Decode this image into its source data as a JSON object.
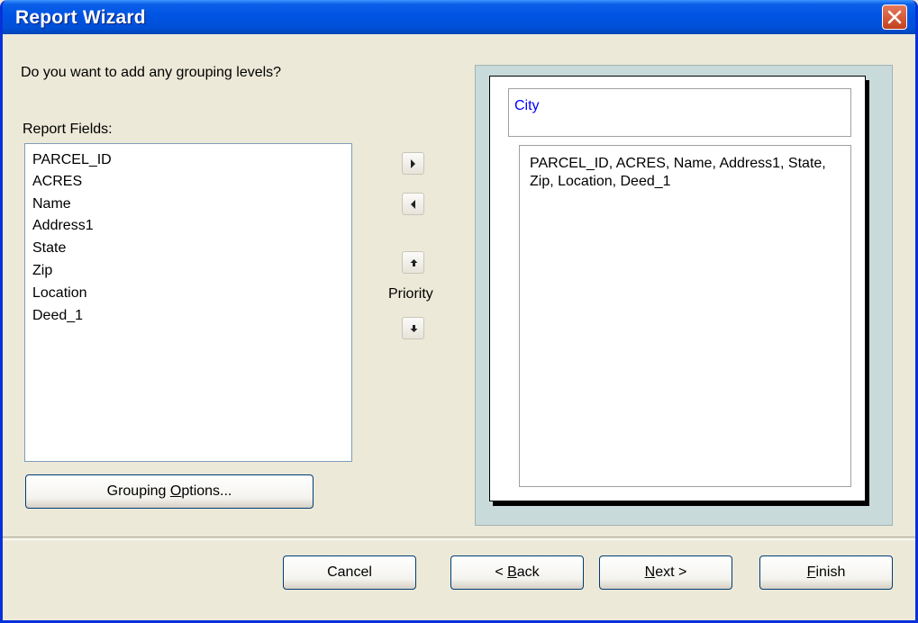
{
  "window": {
    "title": "Report Wizard"
  },
  "prompt": "Do you want to add any grouping levels?",
  "fields_label": "Report Fields:",
  "report_fields": [
    "PARCEL_ID",
    "ACRES",
    "Name",
    "Address1",
    "State",
    "Zip",
    "Location",
    "Deed_1"
  ],
  "grouping_button": {
    "before": "Grouping ",
    "mnemonic": "O",
    "after": "ptions..."
  },
  "priority_label": "Priority",
  "preview": {
    "group_field": "City",
    "detail_fields": "PARCEL_ID, ACRES, Name, Address1, State, Zip, Location, Deed_1"
  },
  "buttons": {
    "cancel": "Cancel",
    "back": {
      "before": "< ",
      "mnemonic": "B",
      "after": "ack"
    },
    "next": {
      "before": "",
      "mnemonic": "N",
      "after": "ext >"
    },
    "finish": {
      "before": "",
      "mnemonic": "F",
      "after": "inish"
    }
  },
  "icons": {
    "close": "close-icon",
    "add": "arrow-right-icon",
    "remove": "arrow-left-icon",
    "up": "arrow-up-icon",
    "down": "arrow-down-icon"
  },
  "colors": {
    "title_bar": "#0054E3",
    "dialog_bg": "#ECE9D8",
    "group_field_text": "#0000FF",
    "close_button": "#C2411E"
  }
}
